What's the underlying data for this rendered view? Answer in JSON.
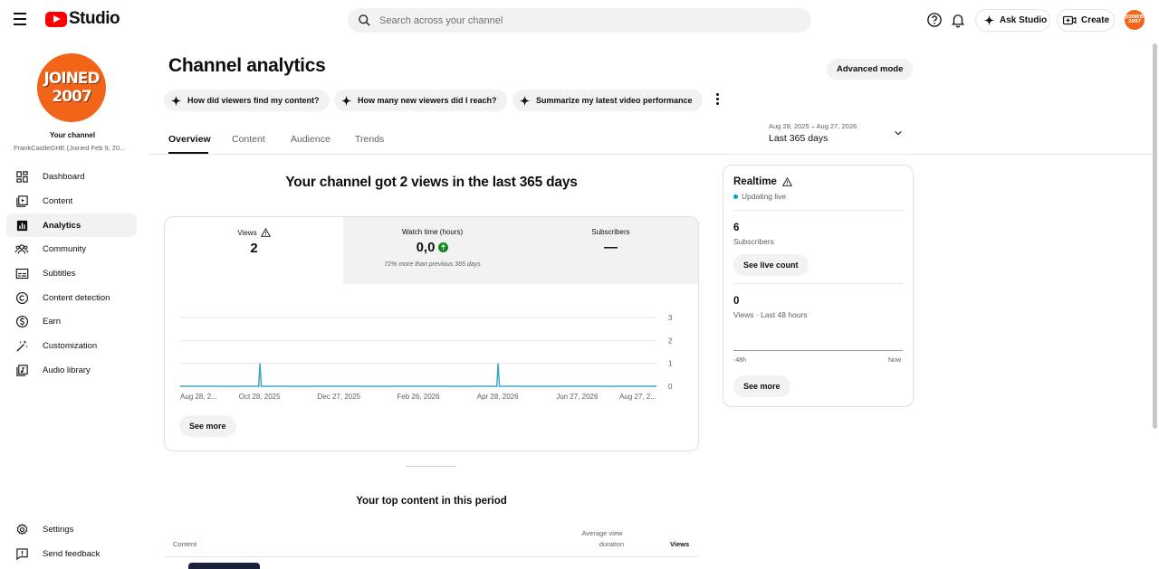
{
  "header": {
    "logo_text": "Studio",
    "search_placeholder": "Search across your channel",
    "ask_studio_label": "Ask Studio",
    "create_label": "Create",
    "avatar_line1": "JOINED",
    "avatar_line2": "2007"
  },
  "sidebar": {
    "avatar_line1": "JOINED",
    "avatar_line2": "2007",
    "your_channel": "Your channel",
    "channel_name": "FrankCastleGHE (Joined Feb 9, 20...",
    "items": [
      {
        "label": "Dashboard",
        "icon": "dashboard-icon"
      },
      {
        "label": "Content",
        "icon": "content-icon"
      },
      {
        "label": "Analytics",
        "icon": "analytics-icon",
        "active": true
      },
      {
        "label": "Community",
        "icon": "community-icon"
      },
      {
        "label": "Subtitles",
        "icon": "subtitles-icon"
      },
      {
        "label": "Content detection",
        "icon": "copyright-icon"
      },
      {
        "label": "Earn",
        "icon": "dollar-icon"
      },
      {
        "label": "Customization",
        "icon": "magic-wand-icon"
      },
      {
        "label": "Audio library",
        "icon": "audio-library-icon"
      }
    ],
    "bottom_items": [
      {
        "label": "Settings",
        "icon": "gear-icon"
      },
      {
        "label": "Send feedback",
        "icon": "feedback-icon"
      }
    ]
  },
  "main": {
    "title": "Channel analytics",
    "advanced_mode_label": "Advanced mode",
    "chips": [
      "How did viewers find my content?",
      "How many new viewers did I reach?",
      "Summarize my latest video performance"
    ],
    "tabs": [
      "Overview",
      "Content",
      "Audience",
      "Trends"
    ],
    "active_tab": "Overview",
    "date_range_small": "Aug 28, 2025 – Aug 27, 2026",
    "date_range_label": "Last 365 days",
    "headline": "Your channel got 2 views in the last 365 days",
    "metrics": {
      "views_label": "Views",
      "views_value": "2",
      "watch_label": "Watch time (hours)",
      "watch_value": "0,0",
      "watch_note": "72% more than previous 365 days",
      "subs_label": "Subscribers",
      "subs_value": "—"
    },
    "see_more_label": "See more",
    "top_content_title": "Your top content in this period",
    "table_headers": {
      "content": "Content",
      "avg_view_line1": "Average view",
      "avg_view_line2": "duration",
      "views": "Views"
    }
  },
  "realtime": {
    "title": "Realtime",
    "status": "Updating live",
    "subscribers_value": "6",
    "subscribers_label": "Subscribers",
    "see_live_count_label": "See live count",
    "views_value": "0",
    "views_label": "Views · Last 48 hours",
    "axis_start": "-48h",
    "axis_end": "Now",
    "see_more_label": "See more"
  },
  "colors": {
    "accent_line": "#3ea6c8",
    "brand_red": "#ff0000",
    "avatar_orange": "#f26418",
    "up_green": "#128a1c"
  },
  "chart_data": {
    "type": "line",
    "x_ticks": [
      "Aug 28, 2...",
      "Oct 28, 2025",
      "Dec 27, 2025",
      "Feb 26, 2026",
      "Apr 28, 2026",
      "Jun 27, 2026",
      "Aug 27, 2..."
    ],
    "y_ticks": [
      "3",
      "2",
      "1",
      "0"
    ],
    "ylim": [
      0,
      3
    ],
    "xlim_days": [
      0,
      364
    ],
    "series": [
      {
        "points": [
          [
            0,
            0
          ],
          [
            60,
            0
          ],
          [
            61,
            1
          ],
          [
            62,
            0
          ],
          [
            242,
            0
          ],
          [
            243,
            1
          ],
          [
            244,
            0
          ],
          [
            364,
            0
          ]
        ]
      }
    ]
  }
}
